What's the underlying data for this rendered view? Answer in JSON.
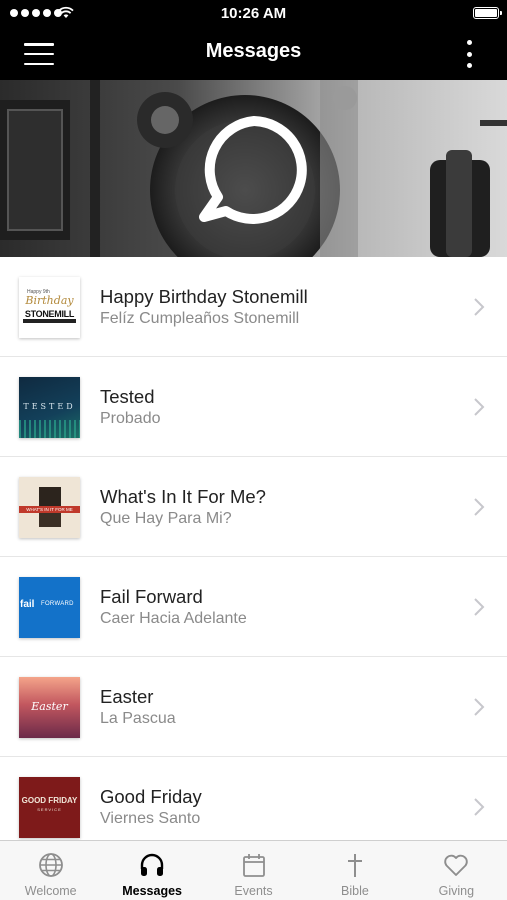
{
  "status_bar": {
    "time": "10:26 AM"
  },
  "nav": {
    "title": "Messages",
    "menu_icon": "hamburger-icon",
    "more_icon": "kebab-icon"
  },
  "banner": {
    "icon": "chat-bubble-icon"
  },
  "messages": [
    {
      "title": "Happy Birthday Stonemill",
      "subtitle": "Felíz Cumpleaños Stonemill",
      "thumb_text": "Birthday",
      "thumb_text_2": "STONEMILL",
      "thumb_top": "Happy 9th"
    },
    {
      "title": "Tested",
      "subtitle": "Probado",
      "thumb_text": "TESTED"
    },
    {
      "title": "What's In It For Me?",
      "subtitle": "Que Hay Para Mi?",
      "thumb_text": "WHAT'S IN IT FOR ME"
    },
    {
      "title": "Fail Forward",
      "subtitle": "Caer Hacia Adelante",
      "thumb_text": "fail",
      "thumb_text_2": "FORWARD"
    },
    {
      "title": "Easter",
      "subtitle": "La Pascua",
      "thumb_text": "Easter"
    },
    {
      "title": "Good Friday",
      "subtitle": "Viernes Santo",
      "thumb_text": "GOOD FRIDAY",
      "thumb_text_2": "SERVICE"
    }
  ],
  "tabs": [
    {
      "label": "Welcome",
      "icon": "globe-icon",
      "active": false
    },
    {
      "label": "Messages",
      "icon": "headphones-icon",
      "active": true
    },
    {
      "label": "Events",
      "icon": "calendar-icon",
      "active": false
    },
    {
      "label": "Bible",
      "icon": "cross-icon",
      "active": false
    },
    {
      "label": "Giving",
      "icon": "heart-icon",
      "active": false
    }
  ],
  "colors": {
    "bar": "#000000",
    "active_tab": "#000000",
    "inactive_tab": "#8e8e8e",
    "subtitle": "#8a8a8a"
  }
}
